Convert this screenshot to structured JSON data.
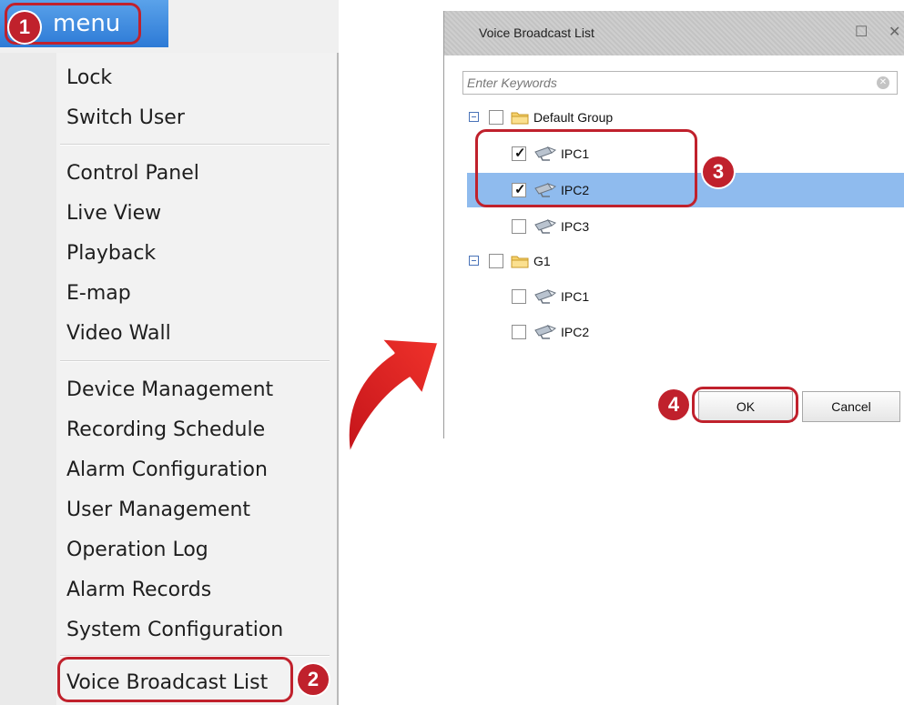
{
  "menu_button": {
    "label": "menu"
  },
  "callouts": [
    "1",
    "2",
    "3",
    "4"
  ],
  "menu": {
    "groups": [
      [
        "Lock",
        "Switch User"
      ],
      [
        "Control Panel",
        "Live View",
        "Playback",
        "E-map",
        "Video Wall"
      ],
      [
        "Device Management",
        "Recording Schedule",
        "Alarm Configuration",
        "User Management",
        "Operation Log",
        "Alarm Records",
        "System Configuration"
      ],
      [
        "Voice Broadcast List"
      ]
    ]
  },
  "dialog": {
    "title": "Voice Broadcast List",
    "search_placeholder": "Enter Keywords",
    "tree": [
      {
        "type": "group",
        "label": "Default Group",
        "checked": false
      },
      {
        "type": "device",
        "label": "IPC1",
        "checked": true
      },
      {
        "type": "device",
        "label": "IPC2",
        "checked": true,
        "selected": true
      },
      {
        "type": "device",
        "label": "IPC3",
        "checked": false
      },
      {
        "type": "group",
        "label": "G1",
        "checked": false
      },
      {
        "type": "device",
        "label": "IPC1",
        "checked": false
      },
      {
        "type": "device",
        "label": "IPC2",
        "checked": false
      }
    ],
    "ok_label": "OK",
    "cancel_label": "Cancel"
  },
  "colors": {
    "accent": "#2d7ad6",
    "highlight": "#c0212c",
    "selection": "#8fbbee",
    "arrow": "#e0201e"
  }
}
